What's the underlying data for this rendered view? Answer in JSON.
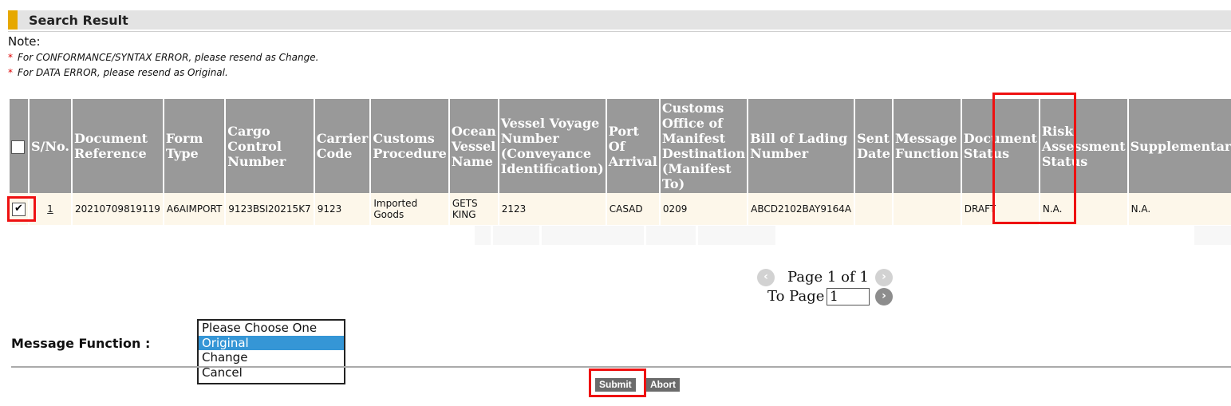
{
  "section": {
    "title": "Search Result"
  },
  "notes": {
    "label": "Note:",
    "lines": [
      {
        "star": "*",
        "text": "For CONFORMANCE/SYNTAX ERROR, please resend as Change."
      },
      {
        "star": "*",
        "text": "For DATA ERROR, please resend as Original."
      }
    ]
  },
  "table": {
    "headers": [
      "S/No.",
      "Document Reference",
      "Form Type",
      "Cargo Control Number",
      "Carrier Code",
      "Customs Procedure",
      "Ocean Vessel Name",
      "Vessel Voyage Number (Conveyance Identification)",
      "Port Of Arrival",
      "Customs Office of Manifest Destination (Manifest To)",
      "Bill of Lading Number",
      "Sent Date",
      "Message Function",
      "Document Status",
      "Risk Assessment Status",
      "Supplementary Match"
    ],
    "rows": [
      {
        "checked": "✔",
        "sno": "1",
        "document_reference": "20210709819119",
        "form_type": "A6AIMPORT",
        "cargo_control_number": "9123BSI20215K7",
        "carrier_code": "9123",
        "customs_procedure": "Imported Goods",
        "ocean_vessel_name": "GETS KING",
        "vessel_voyage_number": "2123",
        "port_of_arrival": "CASAD",
        "customs_office": "0209",
        "bill_of_lading": "ABCD2102BAY9164A",
        "sent_date": "",
        "message_function": "",
        "document_status": "DRAFT",
        "risk_assessment_status": "N.A.",
        "supplementary_match": "N.A."
      }
    ]
  },
  "pagination": {
    "page_text": "Page 1 of 1",
    "to_page_label": "To Page",
    "to_page_value": "1",
    "prev_icon": "‹",
    "next_icon": "›",
    "go_icon": "›"
  },
  "message_function": {
    "label": "Message Function :",
    "options": [
      "Please Choose One",
      "Original",
      "Change",
      "Cancel"
    ],
    "selected": "Original"
  },
  "buttons": {
    "submit": "Submit",
    "abort": "Abort"
  },
  "colors": {
    "header_bg": "#999999",
    "row_bg": "#fdf7ea",
    "accent_bar": "#e6a800",
    "highlight": "#ee1111",
    "selected_option": "#3596d6"
  }
}
